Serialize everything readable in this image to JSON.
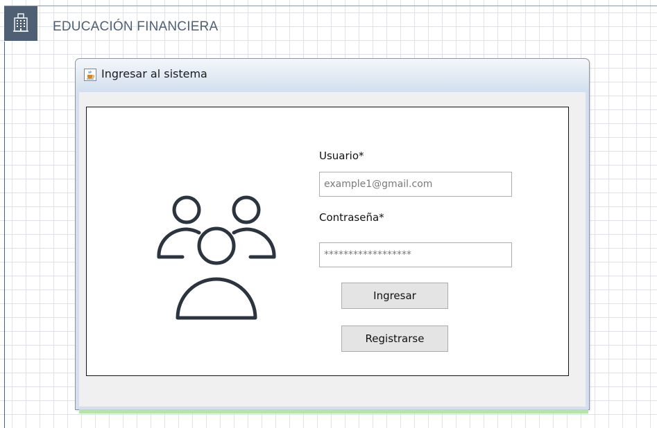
{
  "app": {
    "title": "EDUCACIÓN FINANCIERA",
    "icon": "building-icon",
    "colors": {
      "header": "#4f6074",
      "window_frame": "#d4e0ef",
      "button_bg": "#e4e4e4"
    }
  },
  "login_window": {
    "title": "Ingresar al sistema",
    "icon": "java-cup-icon",
    "illustration_icon": "users-group-icon",
    "username_label": "Usuario*",
    "username_value": "example1@gmail.com",
    "password_label": "Contraseña*",
    "password_value": "******************",
    "login_button": "Ingresar",
    "register_button": "Registrarse"
  }
}
